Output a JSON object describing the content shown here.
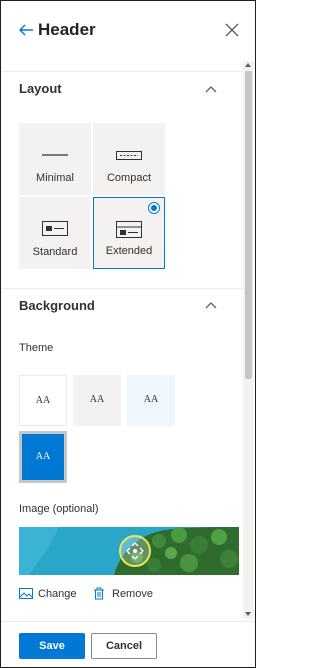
{
  "panel": {
    "title": "Header",
    "back_icon": "arrow-left-icon",
    "close_icon": "close-icon"
  },
  "layout_section": {
    "title": "Layout",
    "collapse_icon": "chevron-up-icon",
    "options": [
      {
        "label": "Minimal",
        "selected": false
      },
      {
        "label": "Compact",
        "selected": false
      },
      {
        "label": "Standard",
        "selected": false
      },
      {
        "label": "Extended",
        "selected": true
      }
    ]
  },
  "background_section": {
    "title": "Background",
    "collapse_icon": "chevron-up-icon",
    "theme_label": "Theme",
    "theme_glyph": "AA",
    "themes": [
      {
        "name": "none",
        "selected": false
      },
      {
        "name": "neutral",
        "selected": false
      },
      {
        "name": "soft",
        "selected": false
      },
      {
        "name": "strong",
        "selected": true
      }
    ],
    "image_label": "Image (optional)",
    "change_label": "Change",
    "remove_label": "Remove"
  },
  "footer": {
    "save_label": "Save",
    "cancel_label": "Cancel"
  },
  "colors": {
    "accent": "#0078d4",
    "focal_ring": "#e8e84a",
    "water": "#2aa6c8",
    "forest": "#2f6b2f"
  }
}
